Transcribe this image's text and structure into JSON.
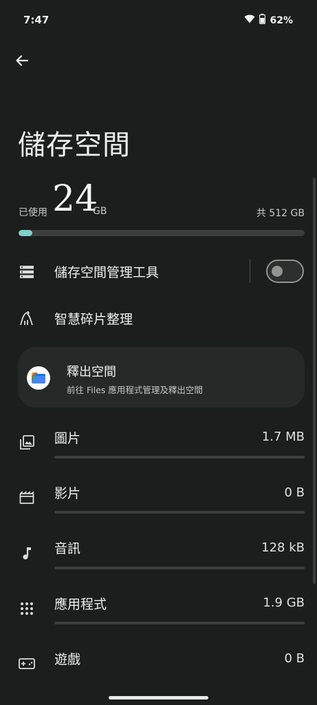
{
  "status": {
    "time": "7:47",
    "battery": "62%",
    "icons": [
      "wifi-icon",
      "battery-icon"
    ]
  },
  "header": {
    "back_icon": "arrow-left-icon",
    "title": "儲存空間"
  },
  "summary": {
    "used_label": "已使用",
    "used_value": "24",
    "used_unit": "GB",
    "total": "共 512 GB",
    "used_fraction": 0.047
  },
  "settings": {
    "storage_manager": {
      "label": "儲存空間管理工具",
      "toggle_on": false,
      "icon": "storage-icon"
    },
    "smart_defrag": {
      "label": "智慧碎片整理",
      "icon": "cleaning-icon"
    }
  },
  "free_up": {
    "title": "釋出空間",
    "subtitle": "前往 Files 應用程式管理及釋出空間",
    "icon": "files-app-icon"
  },
  "categories": [
    {
      "label": "圖片",
      "value": "1.7 MB",
      "icon": "images-icon",
      "fill": 0.0
    },
    {
      "label": "影片",
      "value": "0 B",
      "icon": "video-icon",
      "fill": 0.0
    },
    {
      "label": "音訊",
      "value": "128 kB",
      "icon": "music-note-icon",
      "fill": 0.0
    },
    {
      "label": "應用程式",
      "value": "1.9 GB",
      "icon": "apps-grid-icon",
      "fill": 0.0
    },
    {
      "label": "遊戲",
      "value": "0 B",
      "icon": "gamepad-icon",
      "fill": 0.0
    }
  ],
  "colors": {
    "background": "#1b1e1d",
    "accent": "#7fcfc4",
    "track": "#3a3f3d",
    "card": "#252a28"
  }
}
